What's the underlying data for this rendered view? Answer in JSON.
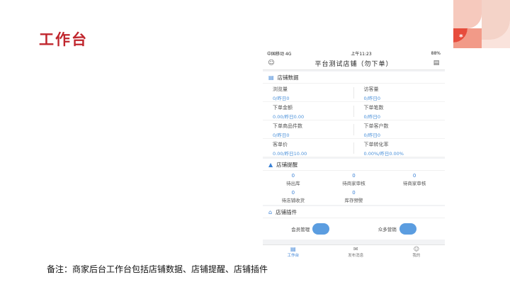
{
  "slide": {
    "title": "工作台",
    "note": "备注：商家后台工作台包括店铺数据、店铺提醒、店铺插件",
    "accent_color": "#c0262d"
  },
  "status_bar": {
    "carrier": "中国移动 4G",
    "time": "上午11:23",
    "battery": "88%"
  },
  "navbar": {
    "title": "平台测试店铺（勿下单）",
    "left_icon": "user-icon",
    "right_icon": "scan-icon"
  },
  "shop_data": {
    "title": "店铺数据",
    "metrics": [
      {
        "label": "浏览量",
        "value": "0/昨日0"
      },
      {
        "label": "访客量",
        "value": "0/昨日0"
      },
      {
        "label": "下单金额",
        "value": "0.00/昨日0.00"
      },
      {
        "label": "下单笔数",
        "value": "0/昨日0"
      },
      {
        "label": "下单商品件数",
        "value": "0/昨日0"
      },
      {
        "label": "下单客户数",
        "value": "0/昨日0"
      },
      {
        "label": "客单价",
        "value": "0.00/昨日10.00"
      },
      {
        "label": "下单转化率",
        "value": "0.00%/昨日0.00%"
      }
    ]
  },
  "shop_reminders": {
    "title": "店铺提醒",
    "items": [
      {
        "count": "0",
        "label": "待出库"
      },
      {
        "count": "0",
        "label": "待商家审核"
      },
      {
        "count": "0",
        "label": "待商家审核"
      },
      {
        "count": "0",
        "label": "待店铺收货"
      },
      {
        "count": "0",
        "label": "库存预警"
      }
    ]
  },
  "shop_plugins": {
    "title": "店铺插件",
    "items": [
      {
        "label": "会员管理"
      },
      {
        "label": "众多营销"
      }
    ]
  },
  "tabbar": {
    "items": [
      {
        "label": "工作台",
        "icon": "dashboard-icon",
        "active": true
      },
      {
        "label": "发布消息",
        "icon": "message-icon",
        "active": false
      },
      {
        "label": "我的",
        "icon": "profile-icon",
        "active": false
      }
    ]
  }
}
